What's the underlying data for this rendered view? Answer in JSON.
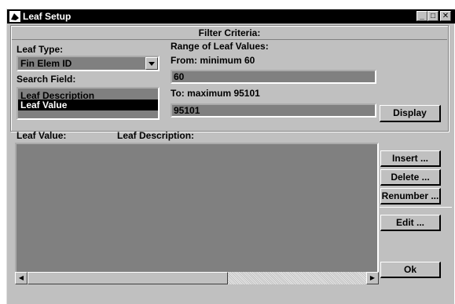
{
  "window": {
    "title": "Leaf Setup",
    "controls": {
      "minimize": "_",
      "maximize": "□",
      "close": "✕"
    }
  },
  "filter": {
    "header": "Filter Criteria:",
    "leaf_type_label": "Leaf Type:",
    "leaf_type_value": "Fin Elem ID",
    "search_field_label": "Search Field:",
    "search_field_options": [
      "Leaf Description",
      "Leaf Value"
    ],
    "search_field_selected": "Leaf Value",
    "range_label": "Range of Leaf Values:",
    "from_label": "From:  minimum 60",
    "from_value": "60",
    "to_label": "To:  maximum 95101",
    "to_value": "95101",
    "display_button": "Display"
  },
  "results": {
    "col_value": "Leaf Value:",
    "col_description": "Leaf Description:"
  },
  "actions": {
    "insert": "Insert ...",
    "delete": "Delete ...",
    "renumber": "Renumber ...",
    "edit": "Edit ...",
    "ok": "Ok"
  }
}
